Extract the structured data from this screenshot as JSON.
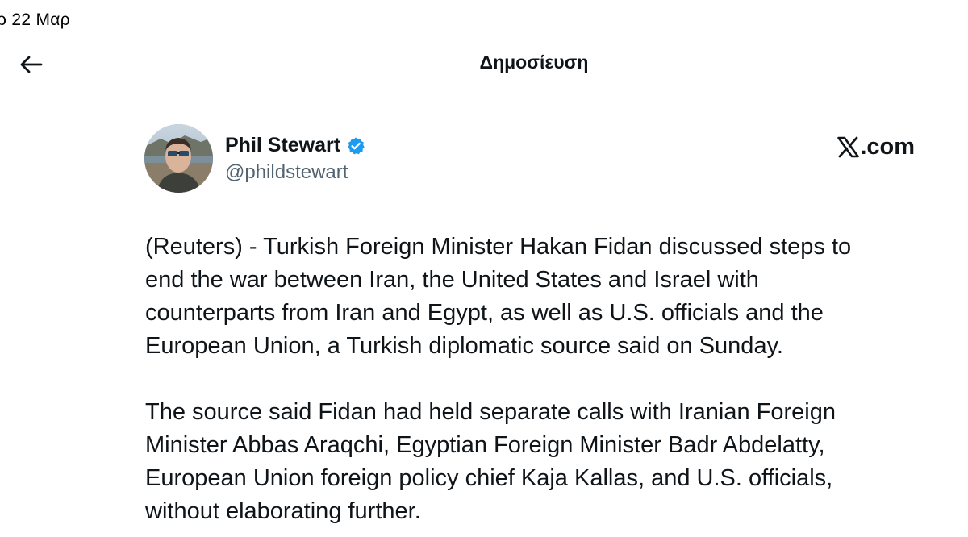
{
  "status_bar": {
    "date": "ρ 22 Μαρ"
  },
  "header": {
    "back_icon": "arrow-left-icon",
    "title": "Δημοσίευση"
  },
  "author": {
    "avatar_icon": "profile-photo",
    "name": "Phil Stewart",
    "verified_icon": "verified-badge-icon",
    "verified_color": "#1d9bf0",
    "handle": "@phildstewart"
  },
  "source": {
    "logo_icon": "x-logo-icon",
    "label": ".com"
  },
  "post": {
    "paragraphs": [
      "(Reuters) - Turkish Foreign Minister Hakan Fidan discussed steps to\nend the war between Iran, the United States and Israel with\ncounterparts from Iran and Egypt, as well as U.S. officials and the\nEuropean Union, a Turkish diplomatic source said on Sunday.",
      "The source said Fidan had held separate calls with Iranian Foreign\nMinister Abbas Araqchi, Egyptian Foreign Minister Badr Abdelatty,\nEuropean Union foreign policy chief Kaja Kallas, and U.S. officials,\nwithout elaborating further."
    ]
  },
  "colors": {
    "text_primary": "#0f1419",
    "text_secondary": "#536471",
    "background": "#ffffff"
  }
}
